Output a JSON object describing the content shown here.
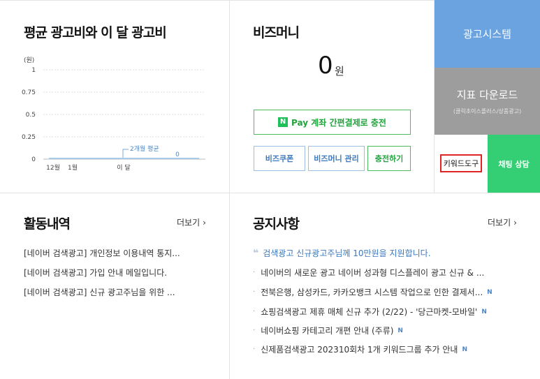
{
  "ad_cost": {
    "title": "평균 광고비와 이 달 광고비"
  },
  "chart_data": {
    "type": "line",
    "unit_label": "(원)",
    "y_ticks": [
      "1",
      "0.75",
      "0.5",
      "0.25",
      "0"
    ],
    "ylim": [
      0,
      1
    ],
    "categories": [
      "12월",
      "1월",
      "이 달"
    ],
    "series": [
      {
        "values": [
          0,
          0,
          0
        ]
      }
    ],
    "annotations": [
      {
        "label": "2개월 평균"
      },
      {
        "label": "0"
      }
    ],
    "grid": true
  },
  "bizmoney": {
    "title": "비즈머니",
    "amount": "0",
    "unit": "원",
    "npay_icon": "N",
    "charge_label": "Pay 계좌 간편결제로 충전",
    "buttons": [
      "비즈쿠폰",
      "비즈머니 관리",
      "충전하기"
    ]
  },
  "tiles": {
    "ad_system": "광고시스템",
    "report_download": "지표 다운로드",
    "report_sub": "(클릭초이스플러스/상품광고)",
    "keyword_tool": "키워드도구",
    "chat_support": "채팅 상담"
  },
  "activity": {
    "title": "활동내역",
    "more": "더보기",
    "items": [
      "[네이버 검색광고] 개인정보 이용내역 통지...",
      "[네이버 검색광고] 가입 안내 메일입니다.",
      "[네이버 검색광고] 신규 광고주님을 위한 ..."
    ]
  },
  "notice": {
    "title": "공지사항",
    "more": "더보기",
    "highlight": "검색광고 신규광고주님께 10만원을 지원합니다.",
    "new_badge": "N",
    "items": [
      {
        "text": "네이버의 새로운 광고 네이버 성과형 디스플레이 광고 신규 & ...",
        "new": false
      },
      {
        "text": "전북은행, 삼성카드, 카카오뱅크 시스템 작업으로 인한 결제서...",
        "new": true
      },
      {
        "text": "쇼핑검색광고 제휴 매체 신규 추가 (2/22) - '당근마켓-모바일'",
        "new": true
      },
      {
        "text": "네이버쇼핑 카테고리 개편 안내 (주류)",
        "new": true
      },
      {
        "text": "신제품검색광고 202310회차 1개 키워드그룹 추가 안내",
        "new": true
      }
    ]
  },
  "colors": {
    "blue_tile": "#6ba2e0",
    "gray_tile": "#9d9d9d",
    "green_tile": "#34cf75",
    "highlight_border": "#e12323",
    "link_blue": "#3b78c0"
  }
}
